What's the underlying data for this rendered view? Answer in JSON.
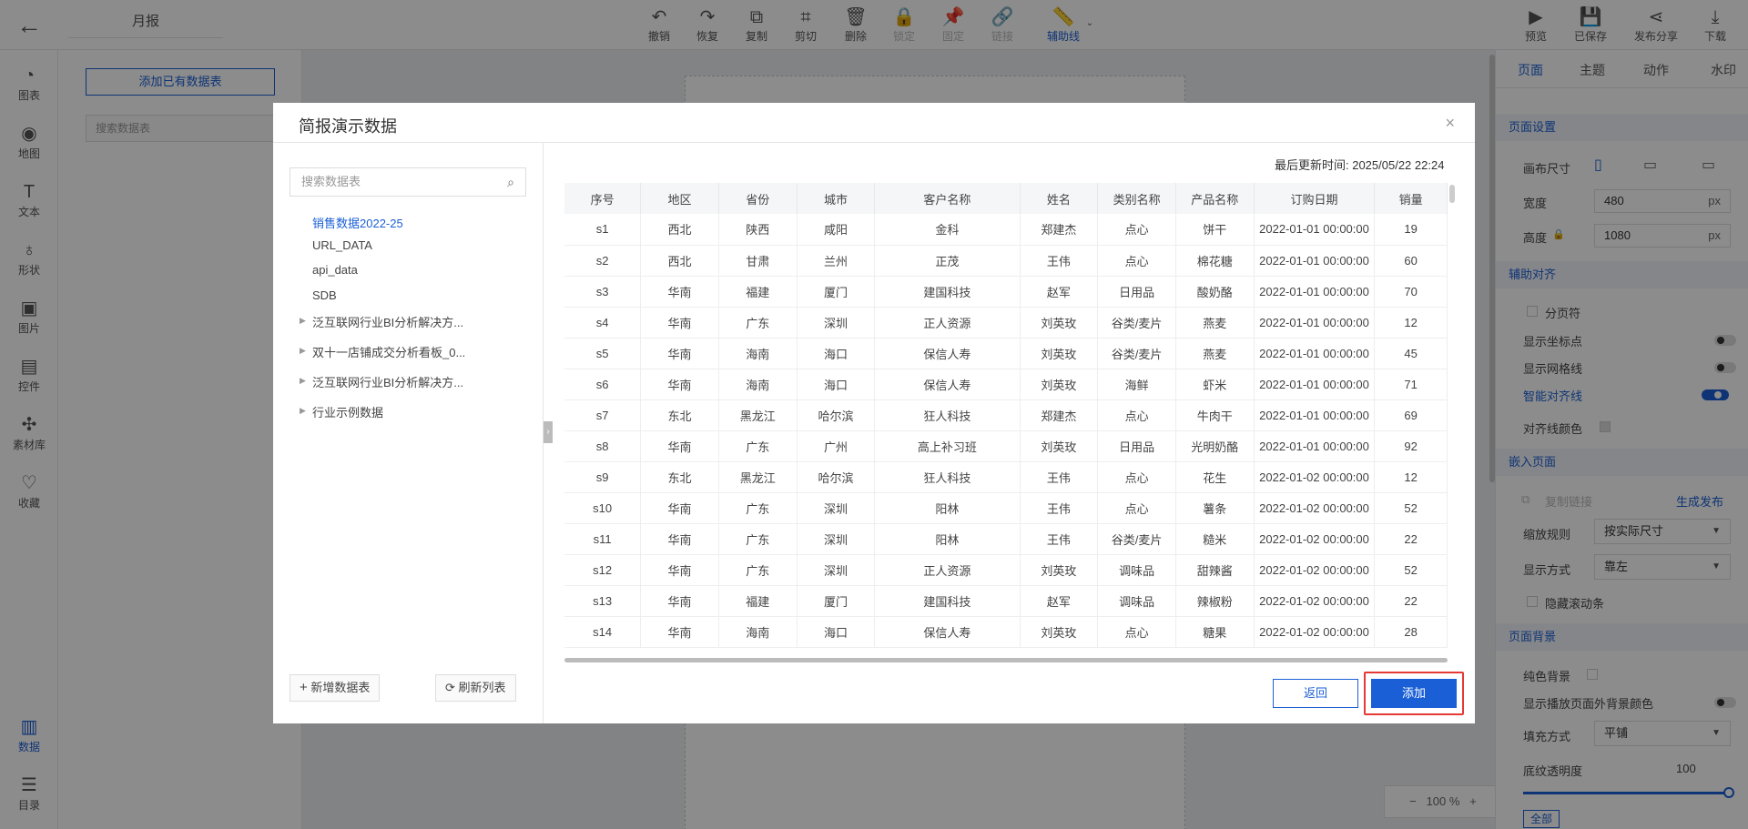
{
  "topbar": {
    "title": "月报",
    "tools": [
      {
        "label": "撤销",
        "icon": "undo-icon",
        "glyph": "↶"
      },
      {
        "label": "恢复",
        "icon": "redo-icon",
        "glyph": "↷"
      },
      {
        "label": "复制",
        "icon": "copy-icon",
        "glyph": "⧉"
      },
      {
        "label": "剪切",
        "icon": "crop-icon",
        "glyph": "⌗"
      },
      {
        "label": "删除",
        "icon": "trash-icon",
        "glyph": "🗑"
      },
      {
        "label": "锁定",
        "icon": "lock-icon",
        "glyph": "🔒"
      },
      {
        "label": "固定",
        "icon": "pin-icon",
        "glyph": "📌"
      },
      {
        "label": "链接",
        "icon": "link-icon",
        "glyph": "🔗"
      },
      {
        "label": "辅助线",
        "icon": "ruler-icon",
        "glyph": "📏"
      }
    ],
    "right_tools": [
      {
        "label": "预览",
        "icon": "preview-icon",
        "glyph": "▶"
      },
      {
        "label": "已保存",
        "icon": "save-icon",
        "glyph": "💾"
      },
      {
        "label": "发布分享",
        "icon": "share-icon",
        "glyph": "⋖"
      },
      {
        "label": "下载",
        "icon": "download-icon",
        "glyph": "⤓"
      }
    ]
  },
  "leftnav": {
    "items": [
      {
        "label": "图表",
        "icon": "chart-icon",
        "glyph": "◔"
      },
      {
        "label": "地图",
        "icon": "map-icon",
        "glyph": "◉"
      },
      {
        "label": "文本",
        "icon": "text-icon",
        "glyph": "T"
      },
      {
        "label": "形状",
        "icon": "shape-icon",
        "glyph": "♁"
      },
      {
        "label": "图片",
        "icon": "image-icon",
        "glyph": "▣"
      },
      {
        "label": "控件",
        "icon": "control-icon",
        "glyph": "▤"
      },
      {
        "label": "素材库",
        "icon": "material-icon",
        "glyph": "✣"
      },
      {
        "label": "收藏",
        "icon": "favorite-icon",
        "glyph": "♡"
      }
    ],
    "bottom": [
      {
        "label": "数据",
        "icon": "data-icon",
        "glyph": "▥"
      },
      {
        "label": "目录",
        "icon": "catalog-icon",
        "glyph": "☰"
      }
    ]
  },
  "datapanel": {
    "add_existing": "添加已有数据表",
    "search_placeholder": "搜索数据表"
  },
  "canvas": {
    "zoom": "100 %",
    "zoom_minus": "−",
    "zoom_plus": "+"
  },
  "rightpanel": {
    "tabs": [
      "页面",
      "主题",
      "动作",
      "水印"
    ],
    "page_settings": "页面设置",
    "canvas_size": "画布尺寸",
    "width_label": "宽度",
    "width_value": "480",
    "height_label": "高度",
    "height_value": "1080",
    "unit": "px",
    "align_section": "辅助对齐",
    "pager": "分页符",
    "show_coords": "显示坐标点",
    "show_grid": "显示网格线",
    "smart_align": "智能对齐线",
    "align_color": "对齐线颜色",
    "embed_section": "嵌入页面",
    "copy_link": "复制链接",
    "gen_publish": "生成发布",
    "scale_rule": "缩放规则",
    "scale_value": "按实际尺寸",
    "display_mode": "显示方式",
    "display_value": "靠左",
    "hide_scroll": "隐藏滚动条",
    "bg_section": "页面背景",
    "solid_bg": "纯色背景",
    "show_outside_bg": "显示播放页面外背景颜色",
    "fill_mode": "填充方式",
    "fill_value": "平铺",
    "opacity_label": "底纹透明度",
    "opacity_value": "100",
    "all_button": "全部"
  },
  "modal": {
    "title": "简报演示数据",
    "close": "×",
    "search_placeholder": "搜索数据表",
    "tree": [
      {
        "label": "销售数据2022-25",
        "selected": true,
        "folder": false
      },
      {
        "label": "URL_DATA",
        "selected": false,
        "folder": false
      },
      {
        "label": "api_data",
        "selected": false,
        "folder": false
      },
      {
        "label": "SDB",
        "selected": false,
        "folder": false
      },
      {
        "label": "泛互联网行业BI分析解决方...",
        "selected": false,
        "folder": true
      },
      {
        "label": "双十一店铺成交分析看板_0...",
        "selected": false,
        "folder": true
      },
      {
        "label": "泛互联网行业BI分析解决方...",
        "selected": false,
        "folder": true
      },
      {
        "label": "行业示例数据",
        "selected": false,
        "folder": true
      }
    ],
    "new_table": "新增数据表",
    "refresh": "刷新列表",
    "update_time": "最后更新时间: 2025/05/22 22:24",
    "columns": [
      "序号",
      "地区",
      "省份",
      "城市",
      "客户名称",
      "姓名",
      "类别名称",
      "产品名称",
      "订购日期",
      "销量"
    ],
    "rows": [
      [
        "s1",
        "西北",
        "陕西",
        "咸阳",
        "金科",
        "郑建杰",
        "点心",
        "饼干",
        "2022-01-01 00:00:00",
        "19"
      ],
      [
        "s2",
        "西北",
        "甘肃",
        "兰州",
        "正茂",
        "王伟",
        "点心",
        "棉花糖",
        "2022-01-01 00:00:00",
        "60"
      ],
      [
        "s3",
        "华南",
        "福建",
        "厦门",
        "建国科技",
        "赵军",
        "日用品",
        "酸奶酪",
        "2022-01-01 00:00:00",
        "70"
      ],
      [
        "s4",
        "华南",
        "广东",
        "深圳",
        "正人资源",
        "刘英玫",
        "谷类/麦片",
        "燕麦",
        "2022-01-01 00:00:00",
        "12"
      ],
      [
        "s5",
        "华南",
        "海南",
        "海口",
        "保信人寿",
        "刘英玫",
        "谷类/麦片",
        "燕麦",
        "2022-01-01 00:00:00",
        "45"
      ],
      [
        "s6",
        "华南",
        "海南",
        "海口",
        "保信人寿",
        "刘英玫",
        "海鲜",
        "虾米",
        "2022-01-01 00:00:00",
        "71"
      ],
      [
        "s7",
        "东北",
        "黑龙江",
        "哈尔滨",
        "狂人科技",
        "郑建杰",
        "点心",
        "牛肉干",
        "2022-01-01 00:00:00",
        "69"
      ],
      [
        "s8",
        "华南",
        "广东",
        "广州",
        "高上补习班",
        "刘英玫",
        "日用品",
        "光明奶酪",
        "2022-01-01 00:00:00",
        "92"
      ],
      [
        "s9",
        "东北",
        "黑龙江",
        "哈尔滨",
        "狂人科技",
        "王伟",
        "点心",
        "花生",
        "2022-01-02 00:00:00",
        "12"
      ],
      [
        "s10",
        "华南",
        "广东",
        "深圳",
        "阳林",
        "王伟",
        "点心",
        "薯条",
        "2022-01-02 00:00:00",
        "52"
      ],
      [
        "s11",
        "华南",
        "广东",
        "深圳",
        "阳林",
        "王伟",
        "谷类/麦片",
        "糙米",
        "2022-01-02 00:00:00",
        "22"
      ],
      [
        "s12",
        "华南",
        "广东",
        "深圳",
        "正人资源",
        "刘英玫",
        "调味品",
        "甜辣酱",
        "2022-01-02 00:00:00",
        "52"
      ],
      [
        "s13",
        "华南",
        "福建",
        "厦门",
        "建国科技",
        "赵军",
        "调味品",
        "辣椒粉",
        "2022-01-02 00:00:00",
        "22"
      ],
      [
        "s14",
        "华南",
        "海南",
        "海口",
        "保信人寿",
        "刘英玫",
        "点心",
        "糖果",
        "2022-01-02 00:00:00",
        "28"
      ]
    ],
    "return_button": "返回",
    "add_button": "添加"
  }
}
